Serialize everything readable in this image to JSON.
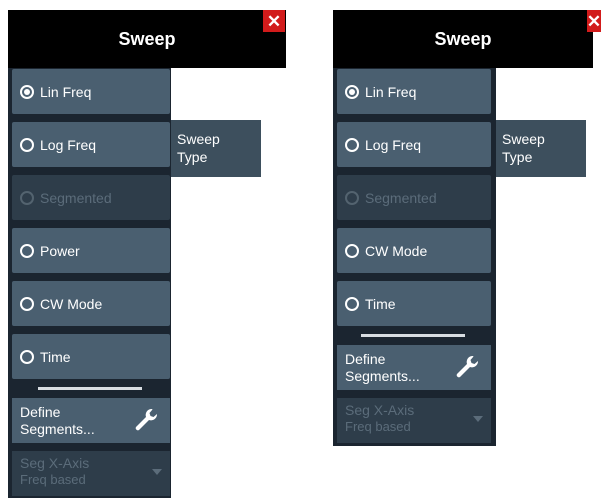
{
  "left_panel": {
    "title": "Sweep",
    "close_label": "✕",
    "items": [
      {
        "label": "Lin Freq",
        "checked": true,
        "enabled": true
      },
      {
        "label": "Log Freq",
        "checked": false,
        "enabled": true
      },
      {
        "label": "Segmented",
        "checked": false,
        "enabled": false
      },
      {
        "label": "Power",
        "checked": false,
        "enabled": true
      },
      {
        "label": "CW Mode",
        "checked": false,
        "enabled": true
      },
      {
        "label": "Time",
        "checked": false,
        "enabled": true
      }
    ],
    "define_label_1": "Define",
    "define_label_2": "Segments...",
    "seg_axis_label": "Seg X-Axis",
    "seg_axis_value": "Freq based",
    "sweep_type_1": "Sweep",
    "sweep_type_2": "Type"
  },
  "right_panel": {
    "title": "Sweep",
    "close_label": "✕",
    "items": [
      {
        "label": "Lin Freq",
        "checked": true,
        "enabled": true
      },
      {
        "label": "Log Freq",
        "checked": false,
        "enabled": true
      },
      {
        "label": "Segmented",
        "checked": false,
        "enabled": false
      },
      {
        "label": "CW Mode",
        "checked": false,
        "enabled": true
      },
      {
        "label": "Time",
        "checked": false,
        "enabled": true
      }
    ],
    "define_label_1": "Define",
    "define_label_2": "Segments...",
    "seg_axis_label": "Seg X-Axis",
    "seg_axis_value": "Freq based",
    "sweep_type_1": "Sweep",
    "sweep_type_2": "Type"
  },
  "colors": {
    "header_bg": "#000000",
    "panel_bg": "#1b2530",
    "button_bg": "#4a5f70",
    "button_disabled_bg": "#2e3d4a",
    "close_bg": "#d21b1b"
  }
}
